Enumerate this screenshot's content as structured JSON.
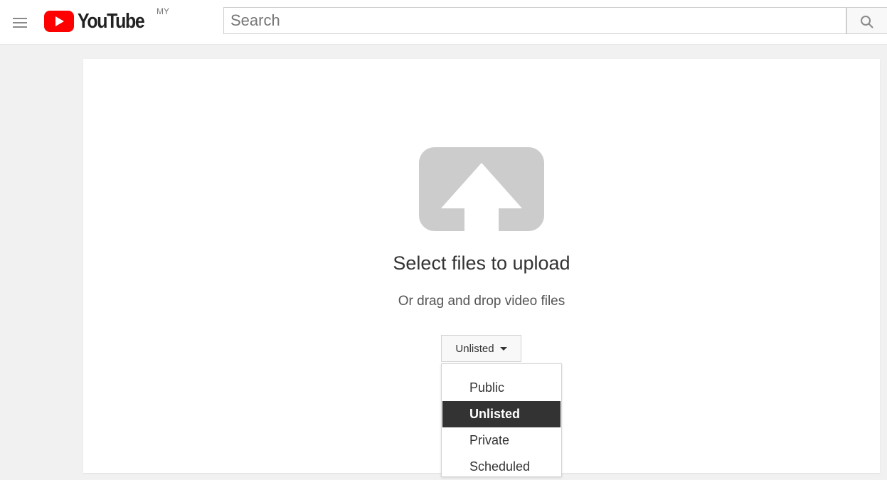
{
  "header": {
    "menu_icon": "hamburger-menu-icon",
    "logo_text": "YouTube",
    "logo_region": "MY",
    "search_placeholder": "Search",
    "search_icon": "search-icon",
    "brand_color": "#ff0000"
  },
  "upload": {
    "icon": "upload-arrow-icon",
    "title": "Select files to upload",
    "subtitle": "Or drag and drop video files",
    "privacy_selected_label": "Unlisted",
    "privacy_options": [
      {
        "label": "Public",
        "selected": false
      },
      {
        "label": "Unlisted",
        "selected": true
      },
      {
        "label": "Private",
        "selected": false
      },
      {
        "label": "Scheduled",
        "selected": false
      }
    ]
  }
}
